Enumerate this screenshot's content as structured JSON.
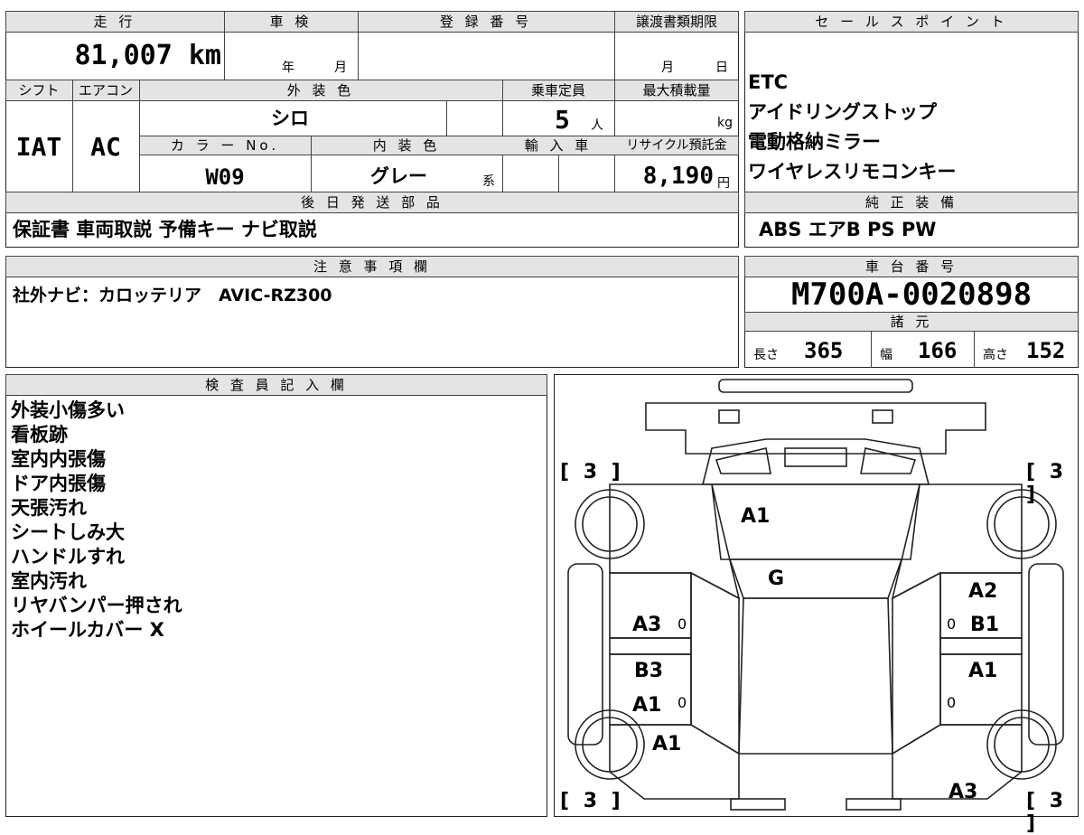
{
  "top_box": {
    "mileage_label": "走 行",
    "mileage_value": "81,007 km",
    "inspection_label": "車 検",
    "inspection_year": "年",
    "inspection_month": "月",
    "registration_label": "登 録 番 号",
    "transfer_label": "譲渡書類期限",
    "transfer_month": "月",
    "transfer_day": "日",
    "shift_label": "シフト",
    "shift_value": "IAT",
    "ac_label": "エアコン",
    "ac_value": "AC",
    "exterior_label": "外 装 色",
    "exterior_value": "シロ",
    "capacity_label": "乗車定員",
    "capacity_value": "5",
    "capacity_unit": "人",
    "load_label": "最大積載量",
    "load_unit": "kg",
    "color_no_label": "カ ラ ー No.",
    "color_no_value": "W09",
    "interior_label": "内 装 色",
    "interior_value": "グレー",
    "interior_suffix": "系",
    "import_label": "輸 入 車",
    "recycle_label": "リサイクル預託金",
    "recycle_value": "8,190",
    "recycle_unit": "円",
    "shipping_label": "後 日 発 送 部 品",
    "shipping_value": "保証書 車両取説 予備キー ナビ取説"
  },
  "sales_points": {
    "label": "セ ー ル ス ポ イ ン ト",
    "items": [
      "ETC",
      "アイドリングストップ",
      "電動格納ミラー",
      "ワイヤレスリモコンキー"
    ]
  },
  "genuine_equipment": {
    "label": "純 正 装 備",
    "value": "ABS エアB PS PW"
  },
  "notes": {
    "label": "注 意 事 項 欄",
    "value": "社外ナビ：カロッテリア　AVIC-RZ300"
  },
  "chassis": {
    "label": "車 台 番 号",
    "value": "M700A-0020898",
    "spec_label": "諸 元",
    "length_label": "長さ",
    "length_value": "365",
    "width_label": "幅",
    "width_value": "166",
    "height_label": "高さ",
    "height_value": "152"
  },
  "inspector": {
    "label": "検 査 員 記 入 欄",
    "lines": [
      "外装小傷多い",
      "看板跡",
      "室内内張傷",
      "ドア内張傷",
      "天張汚れ",
      "シートしみ大",
      "ハンドルすれ",
      "室内汚れ",
      "リヤバンパー押され",
      "ホイールカバー X"
    ]
  },
  "diagram": {
    "tire_marks": [
      "[ 3 ]",
      "[ 3 ]",
      "[ 3 ]",
      "[ 3 ]"
    ],
    "damage": {
      "hood": "A1",
      "windshield": "G",
      "right_front_fender_top": "A2",
      "right_front_fender_bottom": "B1",
      "left_front_door": "A3",
      "right_rear_door": "A1",
      "left_rear_door_top": "B3",
      "left_rear_door_bottom": "A1",
      "left_rear_quarter": "A1",
      "right_rear_quarter": "A3"
    },
    "zero": "0"
  }
}
